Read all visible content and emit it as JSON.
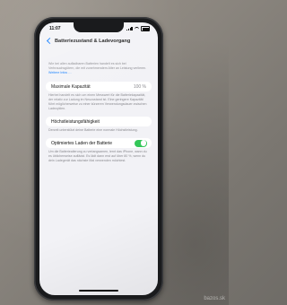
{
  "photo": {
    "watermark": "bazos.sk"
  },
  "status_bar": {
    "time": "11:07"
  },
  "nav": {
    "title": "Batteriezustand & Ladevorgang"
  },
  "intro": {
    "text": "Wie bei allen aufladbaren Batterien handelt es sich bei Verbrauchsgütern, die mit zunehmendem Alter an Leistung verlieren.",
    "link": "Weitere Infos …"
  },
  "max_capacity": {
    "label": "Maximale Kapazität",
    "value": "100 %",
    "footnote": "Hierbei handelt es sich um einen Messwert für die Batteriekapazität, der relativ zur Ladung im Neuzustand ist. Eine geringere Kapazität führt möglicherweise zu einer kürzeren Verwendungsdauer zwischen Ladezyklen."
  },
  "peak_performance": {
    "label": "Höchstleistungsfähigkeit",
    "footnote": "Derzeit unterstützt deine Batterie eine normale Höchstleistung."
  },
  "optimized_charging": {
    "label": "Optimiertes Laden der Batterie",
    "enabled": true,
    "footnote": "Um die Batteriealterung zu verlangsamen, lernt das iPhone, wann du es üblicherweise auflädst. Es lädt dann erst auf über 80 %, wenn du dein Ladegerät das nächste Mal verwenden möchtest."
  }
}
